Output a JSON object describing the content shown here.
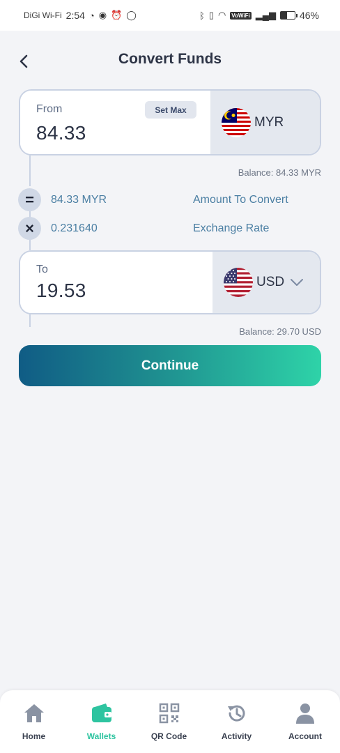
{
  "status_bar": {
    "carrier": "DiGi Wi-Fi",
    "time": "2:54",
    "wifi_badge": "VoWiFi",
    "battery": "46%",
    "battery_level": 0.46
  },
  "header": {
    "title": "Convert Funds",
    "back_icon": "chevron-left-icon"
  },
  "from": {
    "label": "From",
    "amount": "84.33",
    "set_max_label": "Set Max",
    "currency": "MYR",
    "flag_icon": "malaysia-flag-icon",
    "balance": "Balance: 84.33 MYR"
  },
  "summary": {
    "amount_symbol": "=",
    "amount_value": "84.33 MYR",
    "amount_label": "Amount To Convert",
    "rate_symbol": "×",
    "rate_value": "0.231640",
    "rate_label": "Exchange Rate"
  },
  "to": {
    "label": "To",
    "amount": "19.53",
    "currency": "USD",
    "flag_icon": "usa-flag-icon",
    "dropdown_icon": "chevron-down-icon",
    "balance": "Balance: 29.70 USD"
  },
  "continue_label": "Continue",
  "nav": {
    "items": [
      {
        "label": "Home",
        "icon": "home-icon"
      },
      {
        "label": "Wallets",
        "icon": "wallet-icon",
        "active": true
      },
      {
        "label": "QR Code",
        "icon": "qr-code-icon"
      },
      {
        "label": "Activity",
        "icon": "history-icon"
      },
      {
        "label": "Account",
        "icon": "user-icon"
      }
    ],
    "active_color": "#2ec4a0",
    "inactive_color": "#8a93a3"
  },
  "colors": {
    "accent_start": "#105c85",
    "accent_end": "#2ed3a8",
    "link_text": "#4b7fa3"
  }
}
